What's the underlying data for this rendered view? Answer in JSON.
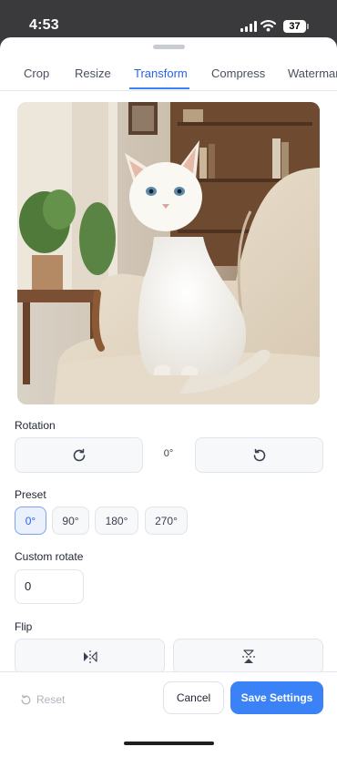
{
  "status_bar": {
    "time": "4:53",
    "battery": "37"
  },
  "tabs": [
    {
      "label": "Crop"
    },
    {
      "label": "Resize"
    },
    {
      "label": "Transform",
      "active": true
    },
    {
      "label": "Compress"
    },
    {
      "label": "Watermark"
    }
  ],
  "rotation": {
    "label": "Rotation",
    "current_degrees": "0°",
    "rotate_right_icon": "rotate-clockwise-icon",
    "rotate_left_icon": "rotate-counterclockwise-icon"
  },
  "preset": {
    "label": "Preset",
    "options": [
      "0°",
      "90°",
      "180°",
      "270°"
    ],
    "selected": "0°"
  },
  "custom_rotate": {
    "label": "Custom rotate",
    "value": "0"
  },
  "flip": {
    "label": "Flip",
    "horizontal_icon": "flip-horizontal-icon",
    "vertical_icon": "flip-vertical-icon"
  },
  "footer": {
    "reset_label": "Reset",
    "cancel_label": "Cancel",
    "save_label": "Save Settings"
  },
  "colors": {
    "accent": "#3b82f6",
    "accent_text": "#2563eb"
  }
}
